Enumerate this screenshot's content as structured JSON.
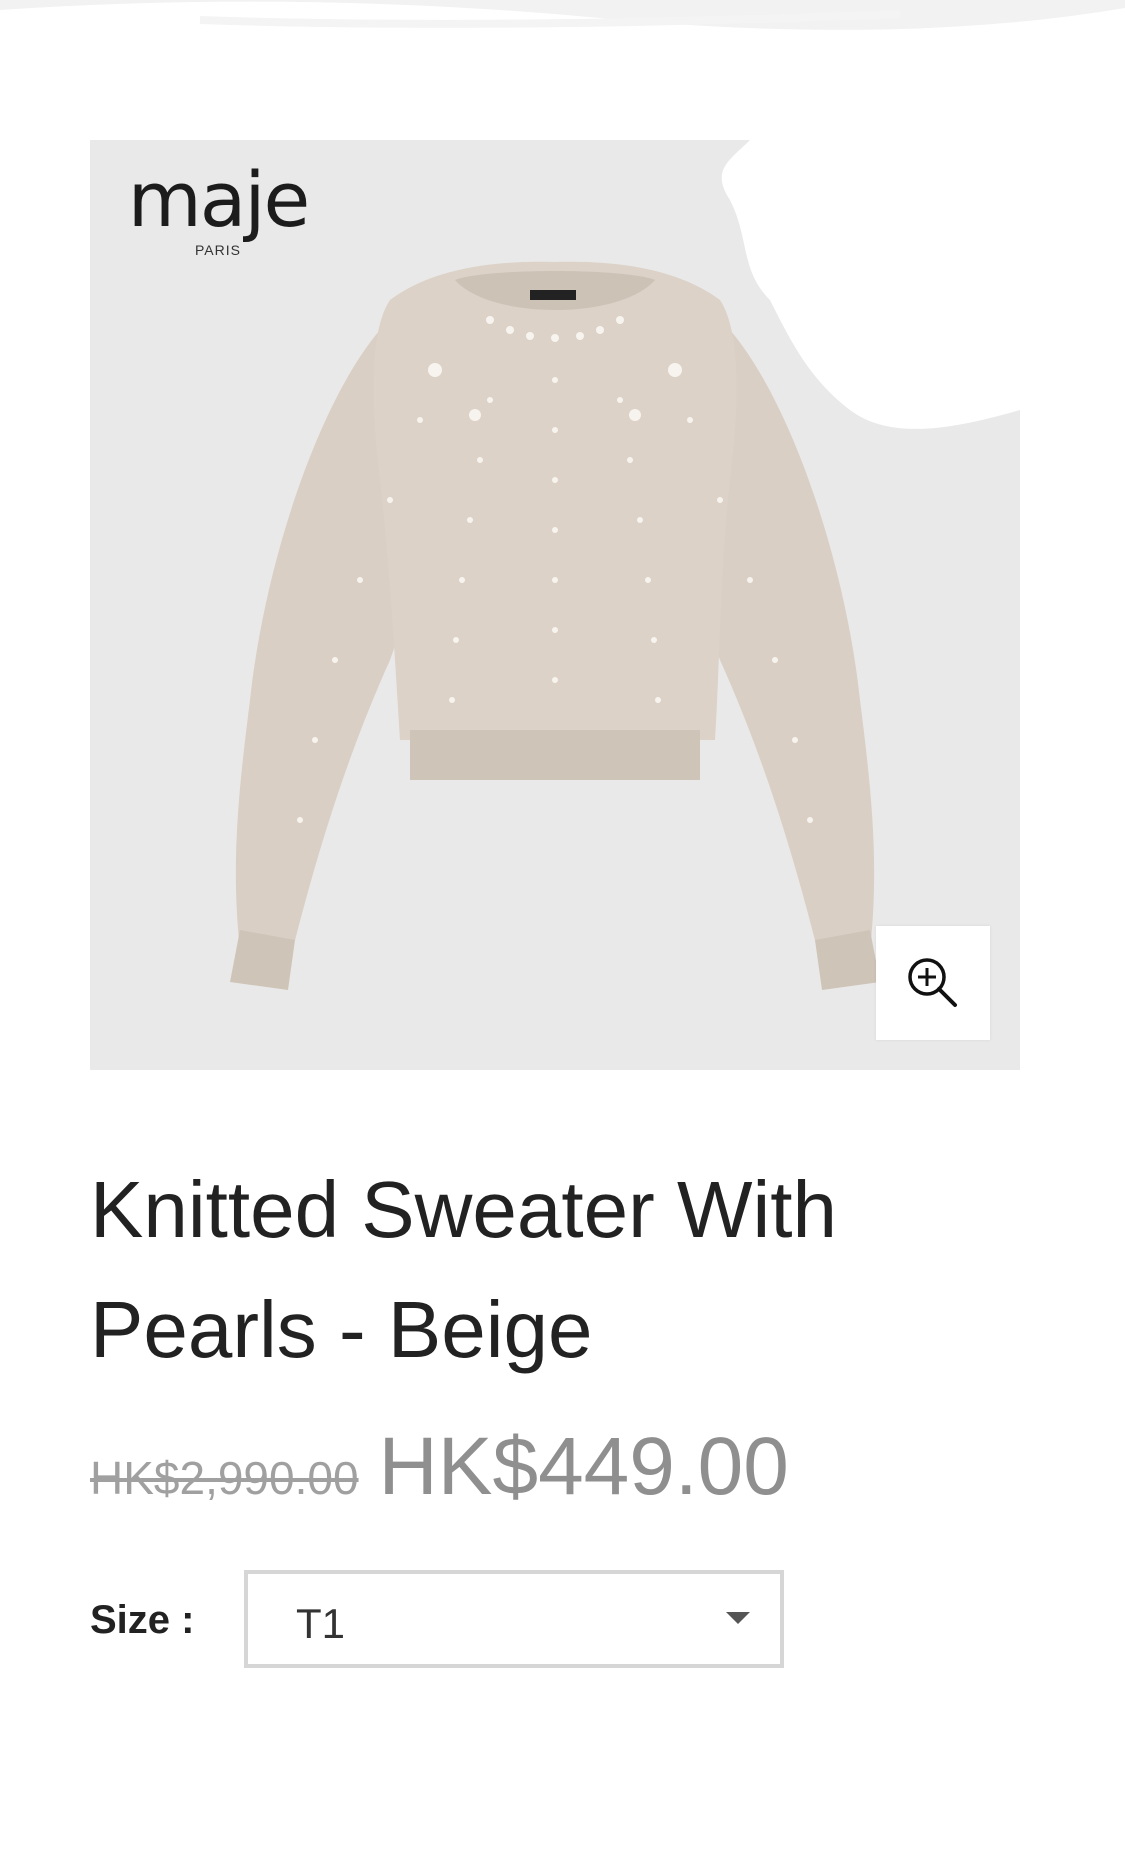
{
  "product": {
    "brand": {
      "name": "maje",
      "sub": "PARIS"
    },
    "title": "Knitted Sweater With Pearls - Beige",
    "price": {
      "original": "HK$2,990.00",
      "sale": "HK$449.00"
    },
    "size": {
      "label": "Size :",
      "selected": "T1"
    },
    "zoom_icon": "zoom-in-icon"
  },
  "colors": {
    "image_bg": "#e9e9e9",
    "sweater": "#d9cfc4",
    "price_gray": "#8f8f8f"
  }
}
